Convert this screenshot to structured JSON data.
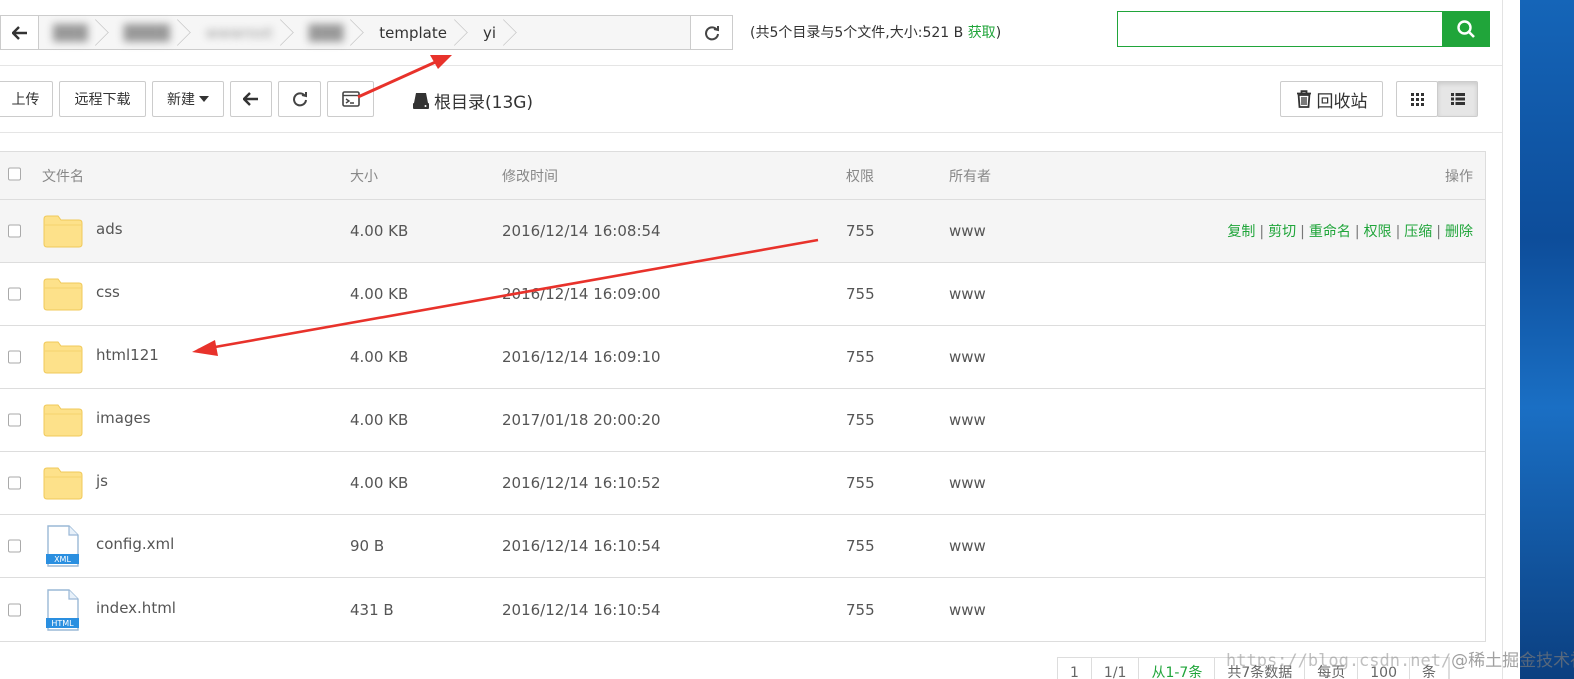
{
  "path": {
    "crumbs": [
      "wwwroot",
      "template",
      "yi"
    ],
    "info_prefix": "(共5个目录与5个文件,大小:521 B",
    "info_link": "获取",
    "info_suffix": ")"
  },
  "search": {
    "value": "",
    "placeholder": ""
  },
  "toolbar": {
    "upload": "上传",
    "remote_download": "远程下载",
    "new": "新建",
    "root_dir": "根目录(13G)",
    "recycle": "回收站"
  },
  "table": {
    "headers": {
      "name": "文件名",
      "size": "大小",
      "time": "修改时间",
      "perm": "权限",
      "owner": "所有者",
      "ops": "操作"
    },
    "ops": [
      "复制",
      "剪切",
      "重命名",
      "权限",
      "压缩",
      "删除"
    ],
    "rows": [
      {
        "name": "ads",
        "size": "4.00 KB",
        "time": "2016/12/14 16:08:54",
        "perm": "755",
        "owner": "www",
        "type": "folder"
      },
      {
        "name": "css",
        "size": "4.00 KB",
        "time": "2016/12/14 16:09:00",
        "perm": "755",
        "owner": "www",
        "type": "folder"
      },
      {
        "name": "html121",
        "size": "4.00 KB",
        "time": "2016/12/14 16:09:10",
        "perm": "755",
        "owner": "www",
        "type": "folder"
      },
      {
        "name": "images",
        "size": "4.00 KB",
        "time": "2017/01/18 20:00:20",
        "perm": "755",
        "owner": "www",
        "type": "folder"
      },
      {
        "name": "js",
        "size": "4.00 KB",
        "time": "2016/12/14 16:10:52",
        "perm": "755",
        "owner": "www",
        "type": "folder"
      },
      {
        "name": "config.xml",
        "size": "90 B",
        "time": "2016/12/14 16:10:54",
        "perm": "755",
        "owner": "www",
        "type": "xml"
      },
      {
        "name": "index.html",
        "size": "431 B",
        "time": "2016/12/14 16:10:54",
        "perm": "755",
        "owner": "www",
        "type": "html"
      }
    ]
  },
  "icons": {
    "xml_tag": "XML",
    "html_tag": "HTML",
    "code_glyph": "</>"
  },
  "pager": [
    "1",
    "1/1",
    "从1-7条",
    "共7条数据",
    "每页",
    "100",
    "条"
  ],
  "watermark": {
    "url": "https://blog.csdn.net/",
    "author": "@稀土掘金技术社区"
  },
  "colors": {
    "accent": "#20a53a",
    "folder": "#fde18a",
    "arrow": "#e8322b"
  }
}
